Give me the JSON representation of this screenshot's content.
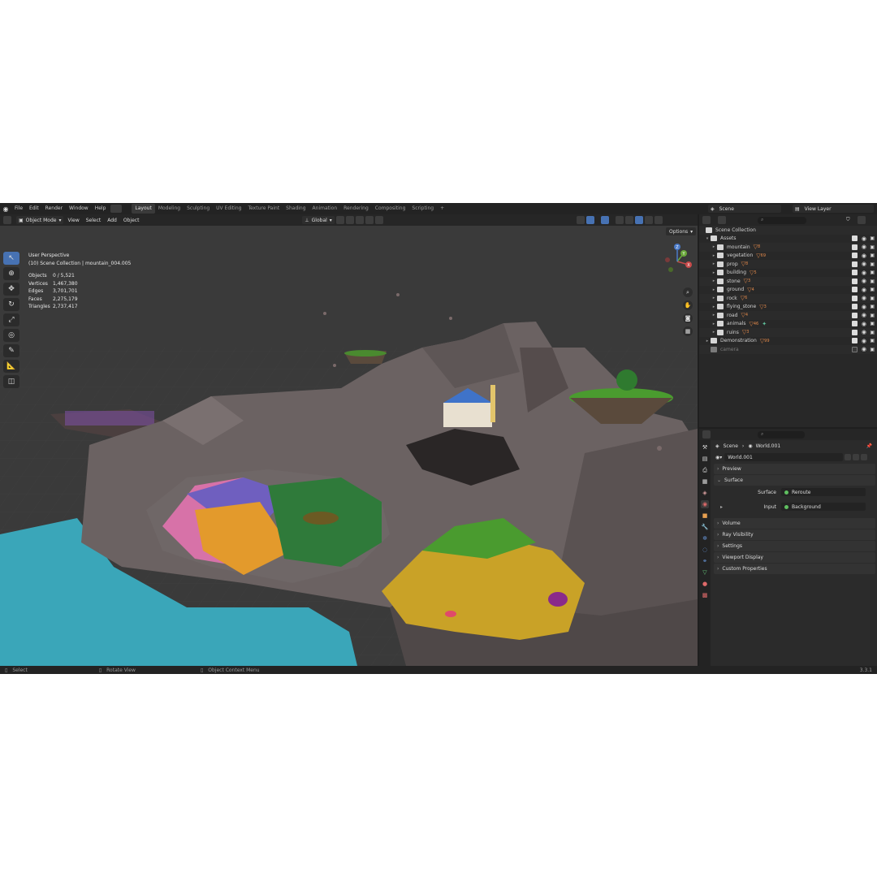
{
  "menu": [
    "File",
    "Edit",
    "Render",
    "Window",
    "Help"
  ],
  "workspaces": [
    {
      "label": "Layout",
      "active": true
    },
    {
      "label": "Modeling"
    },
    {
      "label": "Sculpting"
    },
    {
      "label": "UV Editing"
    },
    {
      "label": "Texture Paint"
    },
    {
      "label": "Shading"
    },
    {
      "label": "Animation"
    },
    {
      "label": "Rendering"
    },
    {
      "label": "Compositing"
    },
    {
      "label": "Scripting"
    },
    {
      "label": "+"
    }
  ],
  "scene": {
    "name": "Scene",
    "view_layer": "View Layer"
  },
  "viewport": {
    "mode": "Object Mode",
    "menus": [
      "View",
      "Select",
      "Add",
      "Object"
    ],
    "orientation": "Global",
    "options": "Options",
    "perspective": "User Perspective",
    "collection": "(10) Scene Collection | mountain_004.005",
    "stats": [
      {
        "label": "Objects",
        "value": "0 / 5,521"
      },
      {
        "label": "Vertices",
        "value": "1,467,380"
      },
      {
        "label": "Edges",
        "value": "3,701,701"
      },
      {
        "label": "Faces",
        "value": "2,275,179"
      },
      {
        "label": "Triangles",
        "value": "2,737,417"
      }
    ],
    "gizmo": {
      "x": "X",
      "y": "Y",
      "z": "Z"
    }
  },
  "outliner": {
    "root": "Scene Collection",
    "assets_label": "Assets",
    "items": [
      {
        "name": "mountain",
        "count": "8"
      },
      {
        "name": "vegetation",
        "count": "69"
      },
      {
        "name": "prop",
        "count": "8"
      },
      {
        "name": "building",
        "count": "5"
      },
      {
        "name": "stone",
        "count": "3"
      },
      {
        "name": "ground",
        "count": "4"
      },
      {
        "name": "rock",
        "count": "6"
      },
      {
        "name": "flying_stone",
        "count": "3"
      },
      {
        "name": "road",
        "count": "4"
      },
      {
        "name": "animals",
        "count": "46"
      },
      {
        "name": "ruins",
        "count": "3"
      }
    ],
    "demonstration": {
      "name": "Demonstration",
      "count": "99"
    },
    "camera": "camera"
  },
  "properties": {
    "breadcrumb_scene": "Scene",
    "breadcrumb_world": "World.001",
    "world_name": "World.001",
    "panels": {
      "preview": "Preview",
      "surface": "Surface",
      "surface_label": "Surface",
      "surface_value": "Reroute",
      "input_label": "Input",
      "input_value": "Background",
      "volume": "Volume",
      "ray_visibility": "Ray Visibility",
      "settings": "Settings",
      "viewport_display": "Viewport Display",
      "custom_properties": "Custom Properties"
    }
  },
  "statusbar": {
    "select": "Select",
    "rotate": "Rotate View",
    "context": "Object Context Menu",
    "version": "3.3.1"
  },
  "colors": {
    "accent": "#4772b3",
    "water": "#3aa6b9",
    "sand": "#c9a227",
    "grass": "#4a9b2f",
    "rock": "#6b6262"
  }
}
